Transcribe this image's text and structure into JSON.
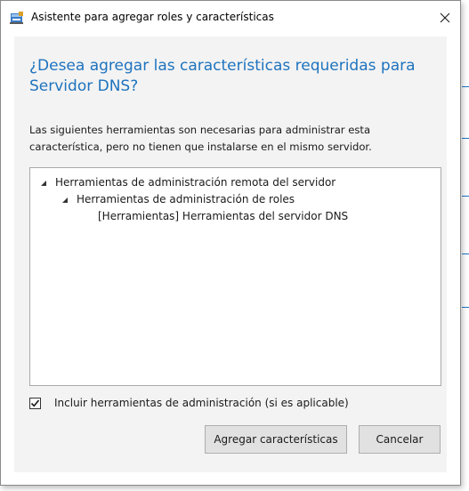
{
  "window": {
    "title": "Asistente para agregar roles y características",
    "close_glyph": "✕"
  },
  "dialog": {
    "heading": "¿Desea agregar las características requeridas para Servidor DNS?",
    "description": "Las siguientes herramientas son necesarias para administrar esta característica, pero no tienen que instalarse en el mismo servidor."
  },
  "tree": {
    "items": [
      {
        "label": "Herramientas de administración remota del servidor",
        "expanded": true
      },
      {
        "label": "Herramientas de administración de roles",
        "expanded": true
      },
      {
        "label": "[Herramientas] Herramientas del servidor DNS",
        "expanded": false
      }
    ]
  },
  "options": {
    "include_tools_label": "Incluir herramientas de administración (si es aplicable)",
    "include_tools_checked": true
  },
  "buttons": {
    "add_label": "Agregar características",
    "cancel_label": "Cancelar"
  },
  "icons": {
    "window_icon": "server-manager-icon",
    "close": "close-icon",
    "expand": "expanded-triangle-icon",
    "check": "checkmark-icon"
  },
  "colors": {
    "heading": "#1e73be",
    "content_background": "#f3f3f3",
    "button_background": "#e1e1e1"
  }
}
